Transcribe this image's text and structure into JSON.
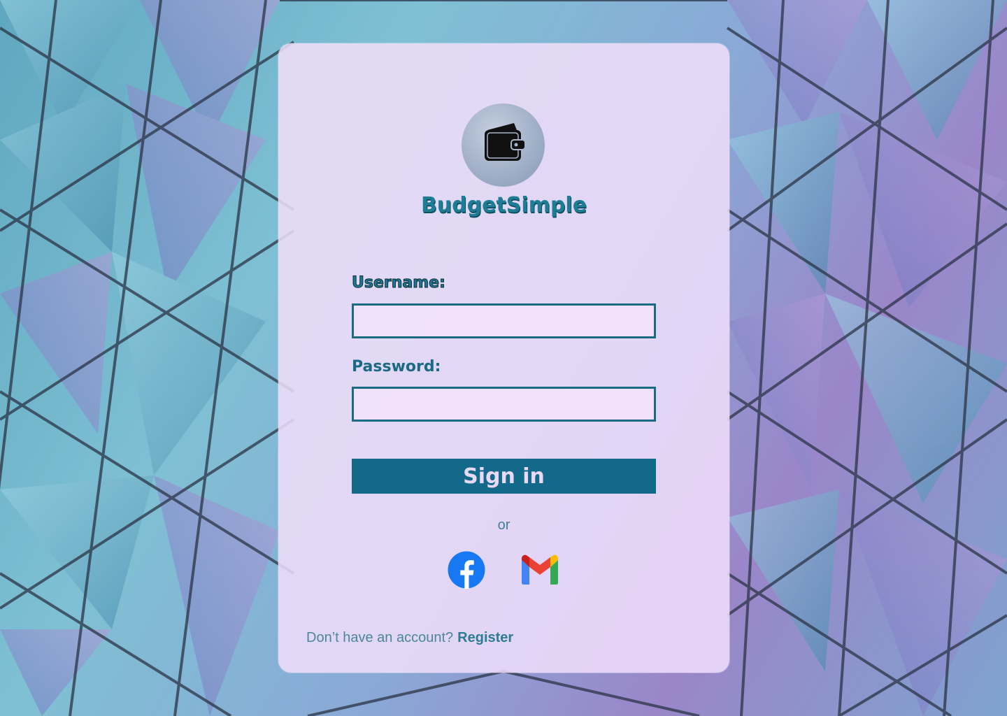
{
  "brand": {
    "name": "BudgetSimple",
    "logo_icon": "wallet-icon"
  },
  "form": {
    "username_label": "Username:",
    "username_value": "",
    "password_label": "Password:",
    "password_value": "",
    "signin_label": "Sign in"
  },
  "divider_text": "or",
  "social": [
    {
      "name": "facebook-icon",
      "color": "#1877F2"
    },
    {
      "name": "gmail-icon",
      "colors": [
        "#4285F4",
        "#EA4335",
        "#FBBC05",
        "#34A853"
      ]
    }
  ],
  "footer": {
    "prompt": "Don’t have an account?",
    "register_label": "Register"
  },
  "colors": {
    "accent": "#12698a",
    "brand_text": "#1f7c95",
    "card_bg": "#f1defa"
  }
}
